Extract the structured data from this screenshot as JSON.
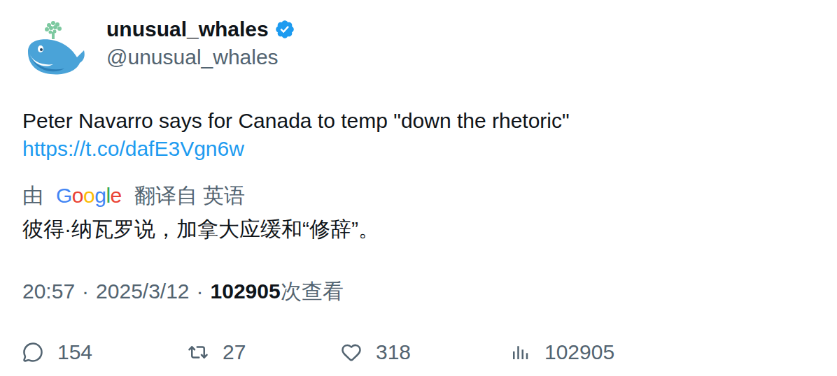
{
  "tweet": {
    "author": {
      "name": "unusual_whales",
      "handle": "@unusual_whales",
      "verified": true
    },
    "text": "Peter Navarro says for Canada to temp \"down the rhetoric\"",
    "link": "https://t.co/dafE3Vgn6w",
    "translation": {
      "prefix": "由",
      "provider": "Google",
      "suffix": "翻译自 英语",
      "text": "彼得·纳瓦罗说，加拿大应缓和“修辞”。"
    },
    "meta": {
      "time": "20:57",
      "separator": "·",
      "date": "2025/3/12",
      "views": "102905",
      "views_label": "次查看"
    },
    "actions": [
      {
        "kind": "reply",
        "count": "154"
      },
      {
        "kind": "retweet",
        "count": "27"
      },
      {
        "kind": "like",
        "count": "318"
      },
      {
        "kind": "views",
        "count": "102905"
      }
    ]
  }
}
